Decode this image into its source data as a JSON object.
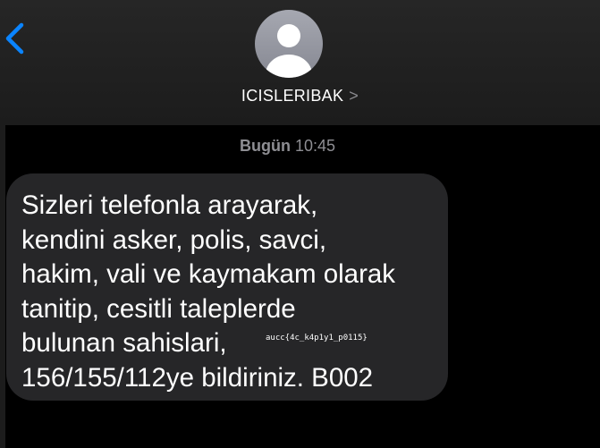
{
  "header": {
    "contact_name": "ICISLERIBAK",
    "contact_chevron": ">",
    "back_icon": "chevron-left-icon",
    "avatar_icon": "person-silhouette-icon"
  },
  "thread": {
    "timestamp_day": "Bugün",
    "timestamp_time": "10:45"
  },
  "message": {
    "lines": [
      "Sizleri telefonla arayarak,",
      "kendini asker, polis, savci,",
      "hakim, vali ve kaymakam olarak",
      "tanitip, cesitli taleplerde",
      "bulunan sahislari,",
      "156/155/112ye bildiriniz. B002"
    ],
    "overlay": "aucc{4c_k4p1y1_p0115}"
  },
  "colors": {
    "accent_blue": "#0a84ff",
    "bubble_gray": "#262628",
    "header_bg": "#262626",
    "muted_text": "#8e8e93"
  }
}
